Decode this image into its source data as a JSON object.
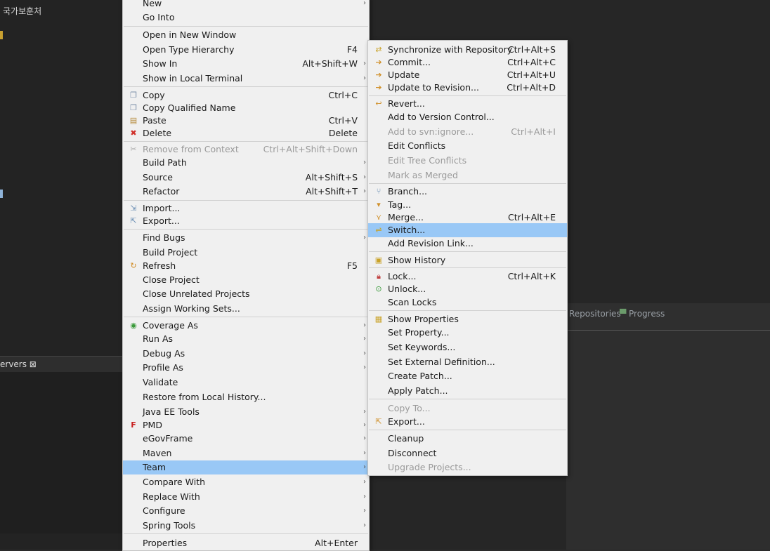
{
  "workspace": {
    "tree_item_1": "국가보훈처",
    "servers_tab": "ervers ⊠",
    "right_tabs": [
      "Repositories",
      "Progress"
    ]
  },
  "main_menu": {
    "items": [
      {
        "label": "New",
        "shortcut": "",
        "submenu": true
      },
      {
        "label": "Go Into",
        "shortcut": "",
        "submenu": false
      },
      {
        "label": "Open in New Window",
        "shortcut": "",
        "submenu": false
      },
      {
        "label": "Open Type Hierarchy",
        "shortcut": "F4",
        "submenu": false
      },
      {
        "label": "Show In",
        "shortcut": "Alt+Shift+W",
        "submenu": true
      },
      {
        "label": "Show in Local Terminal",
        "shortcut": "",
        "submenu": true
      },
      {
        "label": "Copy",
        "shortcut": "Ctrl+C",
        "submenu": false
      },
      {
        "label": "Copy Qualified Name",
        "shortcut": "",
        "submenu": false
      },
      {
        "label": "Paste",
        "shortcut": "Ctrl+V",
        "submenu": false
      },
      {
        "label": "Delete",
        "shortcut": "Delete",
        "submenu": false
      },
      {
        "label": "Remove from Context",
        "shortcut": "Ctrl+Alt+Shift+Down",
        "submenu": false
      },
      {
        "label": "Build Path",
        "shortcut": "",
        "submenu": true
      },
      {
        "label": "Source",
        "shortcut": "Alt+Shift+S",
        "submenu": true
      },
      {
        "label": "Refactor",
        "shortcut": "Alt+Shift+T",
        "submenu": true
      },
      {
        "label": "Import...",
        "shortcut": "",
        "submenu": false
      },
      {
        "label": "Export...",
        "shortcut": "",
        "submenu": false
      },
      {
        "label": "Find Bugs",
        "shortcut": "",
        "submenu": true
      },
      {
        "label": "Build Project",
        "shortcut": "",
        "submenu": false
      },
      {
        "label": "Refresh",
        "shortcut": "F5",
        "submenu": false
      },
      {
        "label": "Close Project",
        "shortcut": "",
        "submenu": false
      },
      {
        "label": "Close Unrelated Projects",
        "shortcut": "",
        "submenu": false
      },
      {
        "label": "Assign Working Sets...",
        "shortcut": "",
        "submenu": false
      },
      {
        "label": "Coverage As",
        "shortcut": "",
        "submenu": true
      },
      {
        "label": "Run As",
        "shortcut": "",
        "submenu": true
      },
      {
        "label": "Debug As",
        "shortcut": "",
        "submenu": true
      },
      {
        "label": "Profile As",
        "shortcut": "",
        "submenu": true
      },
      {
        "label": "Validate",
        "shortcut": "",
        "submenu": false
      },
      {
        "label": "Restore from Local History...",
        "shortcut": "",
        "submenu": false
      },
      {
        "label": "Java EE Tools",
        "shortcut": "",
        "submenu": true
      },
      {
        "label": "PMD",
        "shortcut": "",
        "submenu": true
      },
      {
        "label": "eGovFrame",
        "shortcut": "",
        "submenu": true
      },
      {
        "label": "Maven",
        "shortcut": "",
        "submenu": true
      },
      {
        "label": "Team",
        "shortcut": "",
        "submenu": true
      },
      {
        "label": "Compare With",
        "shortcut": "",
        "submenu": true
      },
      {
        "label": "Replace With",
        "shortcut": "",
        "submenu": true
      },
      {
        "label": "Configure",
        "shortcut": "",
        "submenu": true
      },
      {
        "label": "Spring Tools",
        "shortcut": "",
        "submenu": true
      },
      {
        "label": "Properties",
        "shortcut": "Alt+Enter",
        "submenu": false
      }
    ]
  },
  "team_menu": {
    "items": [
      {
        "label": "Synchronize with Repository",
        "shortcut": "Ctrl+Alt+S"
      },
      {
        "label": "Commit...",
        "shortcut": "Ctrl+Alt+C"
      },
      {
        "label": "Update",
        "shortcut": "Ctrl+Alt+U"
      },
      {
        "label": "Update to Revision...",
        "shortcut": "Ctrl+Alt+D"
      },
      {
        "label": "Revert...",
        "shortcut": ""
      },
      {
        "label": "Add to Version Control...",
        "shortcut": ""
      },
      {
        "label": "Add to svn:ignore...",
        "shortcut": "Ctrl+Alt+I"
      },
      {
        "label": "Edit Conflicts",
        "shortcut": ""
      },
      {
        "label": "Edit Tree Conflicts",
        "shortcut": ""
      },
      {
        "label": "Mark as Merged",
        "shortcut": ""
      },
      {
        "label": "Branch...",
        "shortcut": ""
      },
      {
        "label": "Tag...",
        "shortcut": ""
      },
      {
        "label": "Merge...",
        "shortcut": "Ctrl+Alt+E"
      },
      {
        "label": "Switch...",
        "shortcut": ""
      },
      {
        "label": "Add Revision Link...",
        "shortcut": ""
      },
      {
        "label": "Show History",
        "shortcut": ""
      },
      {
        "label": "Lock...",
        "shortcut": "Ctrl+Alt+K"
      },
      {
        "label": "Unlock...",
        "shortcut": ""
      },
      {
        "label": "Scan Locks",
        "shortcut": ""
      },
      {
        "label": "Show Properties",
        "shortcut": ""
      },
      {
        "label": "Set Property...",
        "shortcut": ""
      },
      {
        "label": "Set Keywords...",
        "shortcut": ""
      },
      {
        "label": "Set External Definition...",
        "shortcut": ""
      },
      {
        "label": "Create Patch...",
        "shortcut": ""
      },
      {
        "label": "Apply Patch...",
        "shortcut": ""
      },
      {
        "label": "Copy To...",
        "shortcut": ""
      },
      {
        "label": "Export...",
        "shortcut": ""
      },
      {
        "label": "Cleanup",
        "shortcut": ""
      },
      {
        "label": "Disconnect",
        "shortcut": ""
      },
      {
        "label": "Upgrade Projects...",
        "shortcut": ""
      }
    ]
  },
  "colors": {
    "menu_bg": "#f0f0f0",
    "highlight": "#99c8f6",
    "disabled_text": "#9a9a9a",
    "ide_bg": "#2b2b2b"
  }
}
